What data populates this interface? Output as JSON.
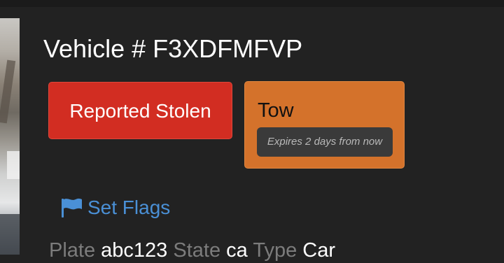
{
  "vehicle": {
    "title": "Vehicle # F3XDFMFVP"
  },
  "badges": {
    "reported_stolen": "Reported Stolen",
    "tow": {
      "label": "Tow",
      "expiry": "Expires 2 days from now"
    }
  },
  "actions": {
    "set_flags": "Set Flags",
    "set_flags_icon": "flag-icon"
  },
  "details": {
    "plate_label": "Plate",
    "plate_value": "abc123",
    "state_label": "State",
    "state_value": "ca",
    "type_label": "Type",
    "type_value": "Car"
  },
  "colors": {
    "stolen": "#d22d22",
    "tow": "#d4722b",
    "link": "#4a90d6",
    "background": "#222222"
  }
}
